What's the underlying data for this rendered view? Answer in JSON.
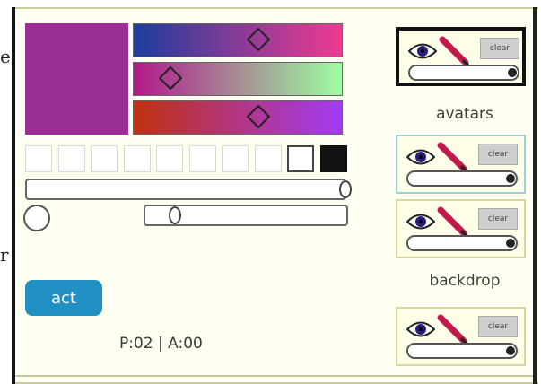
{
  "edge_chars": {
    "top": "e",
    "bottom": "r"
  },
  "main": {
    "action_button_label": "act",
    "status_text": "P:02 | A:00",
    "current_color": "#9b2d96",
    "gradients": [
      {
        "from": "#1c3d9c",
        "to": "#f03a91"
      },
      {
        "from": "#b0198c",
        "to": "#9dffa0"
      },
      {
        "from": "#c0300f",
        "to": "#a33bf4"
      }
    ],
    "palette_boxes": [
      "#ffffff",
      "#ffffff",
      "#ffffff",
      "#ffffff",
      "#ffffff",
      "#ffffff",
      "#ffffff",
      "#ffffff",
      "#ffffff",
      "#111111"
    ]
  },
  "layers": {
    "label_avatars": "avatars",
    "label_backdrop": "backdrop",
    "cards": [
      {
        "clear_label": "clear",
        "active": true
      },
      {
        "clear_label": "clear",
        "active": false
      },
      {
        "clear_label": "clear",
        "active": false
      },
      {
        "clear_label": "clear",
        "active": false
      }
    ]
  }
}
